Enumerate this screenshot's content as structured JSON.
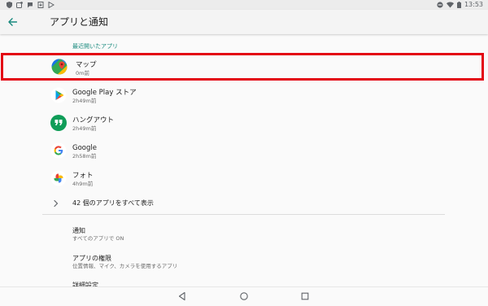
{
  "statusbar": {
    "time": "13:53"
  },
  "appbar": {
    "title": "アプリと通知"
  },
  "recent": {
    "header": "最近開いたアプリ",
    "apps": [
      {
        "name": "マップ",
        "time": "0m前",
        "icon": "google-maps-icon"
      },
      {
        "name": "Google Play ストア",
        "time": "2h49m前",
        "icon": "play-store-icon"
      },
      {
        "name": "ハングアウト",
        "time": "2h49m前",
        "icon": "hangouts-icon"
      },
      {
        "name": "Google",
        "time": "2h58m前",
        "icon": "google-g-icon"
      },
      {
        "name": "フォト",
        "time": "4h9m前",
        "icon": "photos-pinwheel-icon"
      }
    ],
    "see_all": "42 個のアプリをすべて表示"
  },
  "settings": [
    {
      "title": "通知",
      "sub": "すべてのアプリで ON"
    },
    {
      "title": "アプリの権限",
      "sub": "位置情報、マイク、カメラを使用するアプリ"
    },
    {
      "title": "詳細設定",
      "sub": ""
    }
  ],
  "colors": {
    "accent": "#1a8a7e",
    "highlight_border": "#e30613",
    "maps_green": "#34a853",
    "hangouts_green": "#0f9d58"
  }
}
